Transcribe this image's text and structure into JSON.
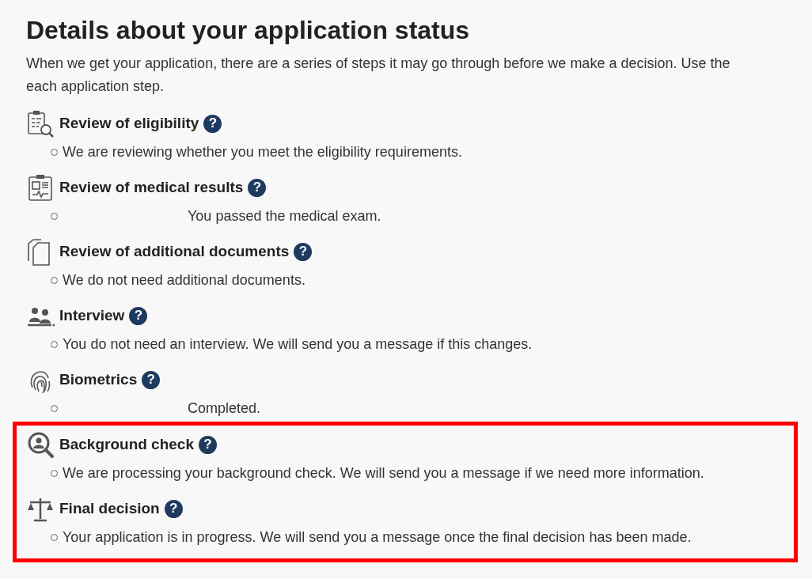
{
  "title": "Details about your application status",
  "intro_lines": [
    "When we get your application, there are a series of steps it may go through before we make a decision. Use the",
    "each application step."
  ],
  "steps": [
    {
      "kind": "eligibility",
      "title": "Review of eligibility",
      "help": "?",
      "message": "We are reviewing whether you meet the eligibility requirements.",
      "indented": false,
      "highlighted": false
    },
    {
      "kind": "medical",
      "title": "Review of medical results",
      "help": "?",
      "message": "You passed the medical exam.",
      "indented": true,
      "highlighted": false
    },
    {
      "kind": "documents",
      "title": "Review of additional documents",
      "help": "?",
      "message": "We do not need additional documents.",
      "indented": false,
      "highlighted": false
    },
    {
      "kind": "interview",
      "title": "Interview",
      "help": "?",
      "message": "You do not need an interview. We will send you a message if this changes.",
      "indented": false,
      "highlighted": false
    },
    {
      "kind": "biometrics",
      "title": "Biometrics",
      "help": "?",
      "message": "Completed.",
      "indented": true,
      "highlighted": false
    },
    {
      "kind": "background",
      "title": "Background check",
      "help": "?",
      "message": "We are processing your background check. We will send you a message if we need more information.",
      "indented": false,
      "highlighted": true
    },
    {
      "kind": "decision",
      "title": "Final decision",
      "help": "?",
      "message": "Your application is in progress. We will send you a message once the final decision has been made.",
      "indented": false,
      "highlighted": true
    }
  ]
}
